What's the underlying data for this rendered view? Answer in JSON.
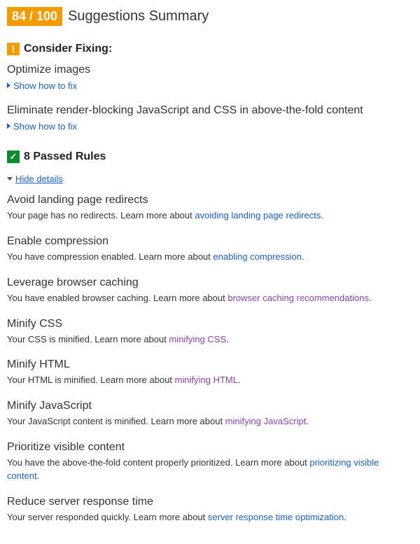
{
  "header": {
    "score_text": "84 / 100",
    "title": "Suggestions Summary"
  },
  "consider_fixing": {
    "icon_glyph": "!",
    "title": "Consider Fixing:",
    "show_how_label": "Show how to fix",
    "items": [
      {
        "title": "Optimize images"
      },
      {
        "title": "Eliminate render-blocking JavaScript and CSS in above-the-fold content"
      }
    ]
  },
  "passed": {
    "icon_glyph": "✓",
    "title": "8 Passed Rules",
    "hide_label": "Hide details",
    "learn_more_prefix": "Learn more about ",
    "items": [
      {
        "title": "Avoid landing page redirects",
        "desc_before": "Your page has no redirects. ",
        "link_text": "avoiding landing page redirects",
        "visited": false
      },
      {
        "title": "Enable compression",
        "desc_before": "You have compression enabled. ",
        "link_text": "enabling compression",
        "visited": false
      },
      {
        "title": "Leverage browser caching",
        "desc_before": "You have enabled browser caching. ",
        "link_text": "browser caching recommendations",
        "visited": true
      },
      {
        "title": "Minify CSS",
        "desc_before": "Your CSS is minified. ",
        "link_text": "minifying CSS",
        "visited": true
      },
      {
        "title": "Minify HTML",
        "desc_before": "Your HTML is minified. ",
        "link_text": "minifying HTML",
        "visited": true
      },
      {
        "title": "Minify JavaScript",
        "desc_before": "Your JavaScript content is minified. ",
        "link_text": "minifying JavaScript",
        "visited": true
      },
      {
        "title": "Prioritize visible content",
        "desc_before": "You have the above-the-fold content properly prioritized. ",
        "link_text": "prioritizing visible content",
        "visited": false
      },
      {
        "title": "Reduce server response time",
        "desc_before": "Your server responded quickly. ",
        "link_text": "server response time optimization",
        "visited": false
      }
    ]
  }
}
